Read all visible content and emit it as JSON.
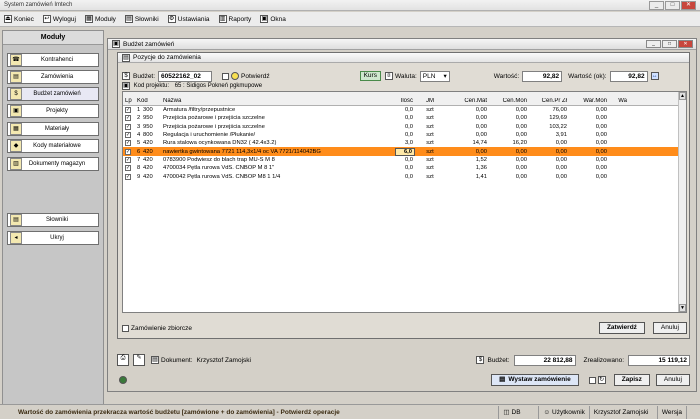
{
  "app": {
    "title": "System zamówień Imtech"
  },
  "menu": [
    {
      "label": "Koniec",
      "icon": "exit-icon"
    },
    {
      "label": "Wyloguj",
      "icon": "logout-icon"
    },
    {
      "label": "Moduły",
      "icon": "modules-icon"
    },
    {
      "label": "Słowniki",
      "icon": "dictionary-icon"
    },
    {
      "label": "Ustawiania",
      "icon": "settings-icon"
    },
    {
      "label": "Raporty",
      "icon": "reports-icon"
    },
    {
      "label": "Okna",
      "icon": "windows-icon"
    }
  ],
  "sidebar": {
    "header": "Moduły",
    "items": [
      {
        "label": "Kontrahenci"
      },
      {
        "label": "Zamówienia"
      },
      {
        "label": "Budżet zamówień"
      },
      {
        "label": "Projekty"
      },
      {
        "label": "Materiały"
      },
      {
        "label": "Kody materiałowe"
      },
      {
        "label": "Dokumenty magazyn"
      }
    ],
    "bottom_items": [
      {
        "label": "Słowniki"
      },
      {
        "label": "Ukryj"
      }
    ]
  },
  "main_window": {
    "title": "Budżet zamówień"
  },
  "dialog": {
    "title": "Pozycje do zamówienia",
    "budget_label": "Budżet:",
    "budget_value": "60522162_02",
    "confirm_label": "Potwierdź",
    "kurs_label": "Kurs",
    "currency_label": "Waluta:",
    "currency_value": "PLN",
    "value_label": "Wartość:",
    "value": "92,82",
    "value_ok_label": "Wartość (ok):",
    "value_ok": "92,82",
    "project_label": "Kod projektu:",
    "project_value": "65 : Sidigos Pokneń pgkmupowe",
    "columns": [
      "Lp",
      "Kod",
      "Nazwa",
      "Ilość",
      "JM",
      "Cen.Mat",
      "Cen.Mon",
      "Cen.Pr Zł",
      "War.Mon",
      "Wa"
    ],
    "rows": [
      {
        "lp": "1",
        "kod": "300",
        "nazwa": "Armatura /filtry/przepustnice",
        "ilosc": "0,0",
        "jm": "szt",
        "mat": "0,00",
        "mon": "0,00",
        "pr": "76,00",
        "war": "0,00",
        "sel": false
      },
      {
        "lp": "2",
        "kod": "950",
        "nazwa": "Przejścia pożarowe i przejścia szczelne",
        "ilosc": "0,0",
        "jm": "szt",
        "mat": "0,00",
        "mon": "0,00",
        "pr": "129,69",
        "war": "0,00",
        "sel": false
      },
      {
        "lp": "3",
        "kod": "950",
        "nazwa": "Przejścia pożarowe i przejścia szczelne",
        "ilosc": "0,0",
        "jm": "szt",
        "mat": "0,00",
        "mon": "0,00",
        "pr": "103,22",
        "war": "0,00",
        "sel": false
      },
      {
        "lp": "4",
        "kod": "800",
        "nazwa": "Regulacja i uruchomienie /Płukanie/",
        "ilosc": "0,0",
        "jm": "szt",
        "mat": "0,00",
        "mon": "0,00",
        "pr": "3,91",
        "war": "0,00",
        "sel": false
      },
      {
        "lp": "5",
        "kod": "420",
        "nazwa": "Rura stalowa ocynkowana DN32 ( 42.4x3.2)",
        "ilosc": "3,0",
        "jm": "szt",
        "mat": "14,74",
        "mon": "16,20",
        "pr": "0,00",
        "war": "0,00",
        "sel": false
      },
      {
        "lp": "6",
        "kod": "420",
        "nazwa": "nawiertka gwintowana 7721 114,3x1/4 oc VA 7721/114042BG",
        "ilosc": "6,0",
        "jm": "szt",
        "mat": "0,00",
        "mon": "0,00",
        "pr": "0,00",
        "war": "0,00",
        "sel": true
      },
      {
        "lp": "7",
        "kod": "420",
        "nazwa": "0783900 Podwiesz do blach trap MU-S M 8",
        "ilosc": "0,0",
        "jm": "szt",
        "mat": "1,52",
        "mon": "0,00",
        "pr": "0,00",
        "war": "0,00",
        "sel": false
      },
      {
        "lp": "8",
        "kod": "420",
        "nazwa": "4700034 Pętla rurowa VdS. CNBOP M 8 1\"",
        "ilosc": "0,0",
        "jm": "szt",
        "mat": "1,36",
        "mon": "0,00",
        "pr": "0,00",
        "war": "0,00",
        "sel": false
      },
      {
        "lp": "9",
        "kod": "420",
        "nazwa": "4700042 Pętla rurowa VdS. CNBOP M8 1 1/4",
        "ilosc": "0,0",
        "jm": "szt",
        "mat": "1,41",
        "mon": "0,00",
        "pr": "0,00",
        "war": "0,00",
        "sel": false
      }
    ],
    "zbiorcze_label": "Zamówienie zbiorcze",
    "confirm_button": "Zatwierdź",
    "cancel_button": "Anuluj"
  },
  "footer": {
    "document_label": "Dokument:",
    "document_value": "Krzysztof Zamojski",
    "budget_label": "Budżet:",
    "budget_value": "22 812,88",
    "realized_label": "Zrealizowano:",
    "realized_value": "15 119,12",
    "issue_button": "Wystaw zamówienie",
    "save_button": "Zapisz",
    "cancel_button": "Anuluj"
  },
  "statusbar": {
    "message": "Wartość do zamówienia przekracza wartość budżetu [zamówione + do zamówienia] - Potwierdź operacje",
    "db": "DB",
    "user_label": "Użytkownik",
    "user": "Krzysztof Zamojski",
    "version_label": "Wersja"
  }
}
